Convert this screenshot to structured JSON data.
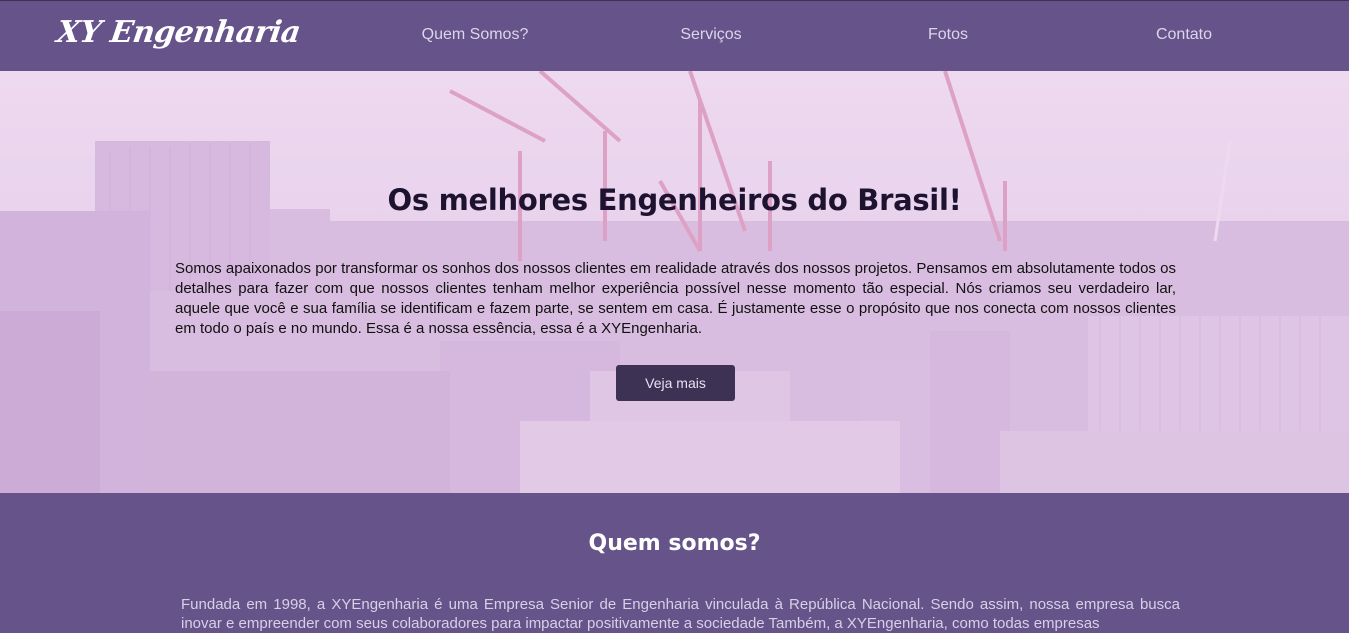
{
  "header": {
    "brand": "XY Engenharia",
    "nav": [
      {
        "label": "Quem Somos?"
      },
      {
        "label": "Serviços"
      },
      {
        "label": "Fotos"
      },
      {
        "label": "Contato"
      }
    ]
  },
  "hero": {
    "title": "Os melhores Engenheiros do Brasil!",
    "text": "Somos apaixonados por transformar os sonhos dos nossos clientes em realidade através dos nossos projetos. Pensamos em absolutamente todos os detalhes para fazer com que nossos clientes tenham melhor experiência possível nesse momento tão especial. Nós criamos seu verdadeiro lar, aquele que você e sua família se identificam e fazem parte, se sentem em casa. É justamente esse o propósito que nos conecta com nossos clientes em todo o país e no mundo. Essa é a nossa essência, essa é a XYEngenharia.",
    "button_label": "Veja mais",
    "background": "city-skyline-with-cranes-image"
  },
  "about": {
    "title": "Quem somos?",
    "text": "Fundada em 1998, a XYEngenharia é uma Empresa Senior de Engenharia vinculada à República Nacional. Sendo assim, nossa empresa busca inovar e empreender com seus colaboradores para impactar positivamente a sociedade Também, a XYEngenharia, como todas empresas"
  },
  "colors": {
    "nav_background": "#65538a",
    "button_background": "#3d3154",
    "hero_tint": "#e6d0ea"
  }
}
